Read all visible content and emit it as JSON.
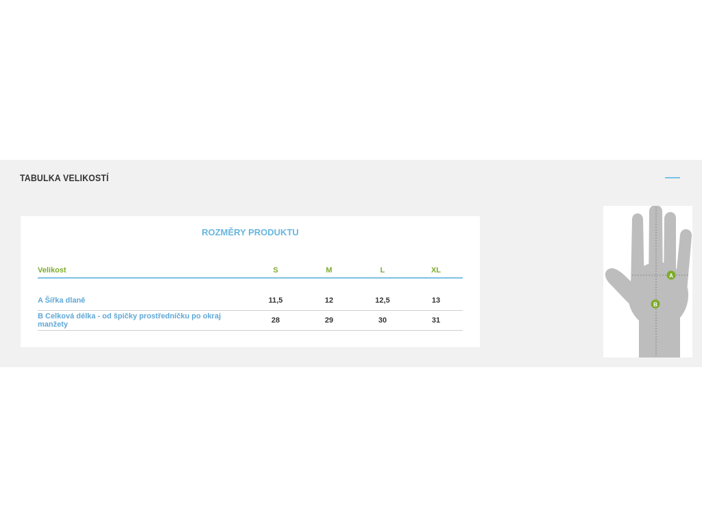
{
  "section": {
    "title": "TABULKA VELIKOSTÍ"
  },
  "colors": {
    "accent_blue": "#68b6e0",
    "accent_green": "#7dab2c",
    "band_background": "#f1f1f1"
  },
  "table": {
    "title": "ROZMĚRY PRODUKTU",
    "header_label": "Velikost",
    "sizes": [
      "S",
      "M",
      "L",
      "XL"
    ],
    "rows": [
      {
        "label": "A Šířka dlaně",
        "values": [
          "11,5",
          "12",
          "12,5",
          "13"
        ]
      },
      {
        "label": "B Celková délka - od špičky prostředníčku po okraj manžety",
        "values": [
          "28",
          "29",
          "30",
          "31"
        ]
      }
    ]
  },
  "hand_diagram": {
    "marker_a": "A",
    "marker_b": "B"
  }
}
